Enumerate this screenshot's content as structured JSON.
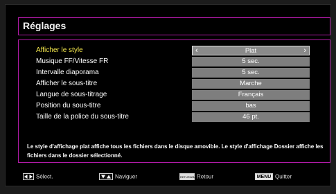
{
  "title": "Réglages",
  "settings": [
    {
      "label": "Afficher le style",
      "value": "Plat",
      "selected": true
    },
    {
      "label": "Musique FF/Vitesse FR",
      "value": "5 sec."
    },
    {
      "label": "Intervalle diaporama",
      "value": "5 sec."
    },
    {
      "label": "Afficher le sous-titre",
      "value": "Marche"
    },
    {
      "label": "Langue de sous-titrage",
      "value": "Français"
    },
    {
      "label": "Position du sous-titre",
      "value": "bas"
    },
    {
      "label": "Taille de la police du sous-titre",
      "value": "46 pt."
    }
  ],
  "help_text": "Le style d'affichage plat affiche tous les fichiers dans le disque amovible. Le style d'affichage Dossier affiche les fichiers dans le dossier sélectionné.",
  "footer": {
    "select_label": "Sélect.",
    "navigate_label": "Naviguer",
    "back_key": "RETURN/BACK",
    "back_label": "Retour",
    "menu_key": "MENU",
    "quit_label": "Quitter"
  },
  "colors": {
    "accent_border": "#b21aa8",
    "highlight_text": "#f5e94c",
    "value_box": "#7e7e7e"
  },
  "icons": {
    "select": "left-right-arrows-icon",
    "navigate": "up-down-arrows-icon",
    "back": "back-key-icon",
    "menu": "menu-key-icon"
  }
}
